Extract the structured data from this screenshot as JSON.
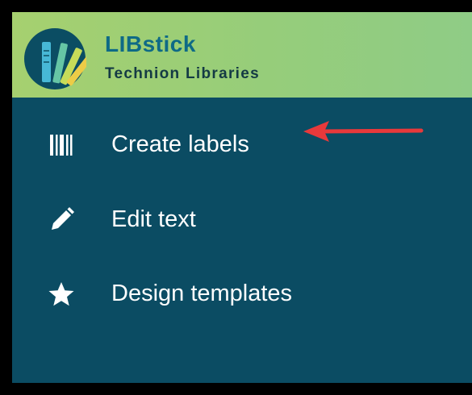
{
  "brand": {
    "name": "LIBstick",
    "subtitle": "Technion Libraries",
    "logo_icon": "book-spines-fan-icon"
  },
  "nav": {
    "items": [
      {
        "label": "Create labels",
        "icon": "barcode-icon"
      },
      {
        "label": "Edit text",
        "icon": "pencil-icon"
      },
      {
        "label": "Design templates",
        "icon": "star-icon"
      }
    ]
  },
  "annotation": {
    "arrow_color": "#e8393b",
    "points_to": "Create labels"
  },
  "colors": {
    "sidebar_bg": "#0b4c63",
    "header_gradient_start": "#a6d06f",
    "header_gradient_end": "#8fcc86",
    "brand_name": "#0e6a86",
    "nav_text": "#ffffff"
  }
}
